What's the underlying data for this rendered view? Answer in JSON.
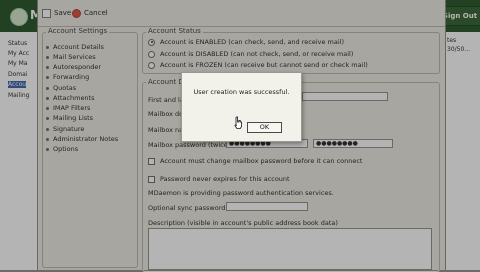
{
  "background_app": {
    "logo_text": "M",
    "sign_out_label": "Sign Out",
    "nav": [
      "Status",
      "My Acc",
      "My Ma",
      "Domai",
      "Accou",
      "Mailing"
    ],
    "right_text": [
      "tes",
      "30/50..."
    ]
  },
  "toolbar": {
    "save_label": "Save",
    "cancel_label": "Cancel"
  },
  "account_settings": {
    "legend": "Account Settings",
    "items": [
      "Account Details",
      "Mail Services",
      "Autoresponder",
      "Forwarding",
      "Quotas",
      "Attachments",
      "IMAP Filters",
      "Mailing Lists",
      "Signature",
      "Administrator Notes",
      "Options"
    ]
  },
  "account_status": {
    "legend": "Account Status",
    "options": [
      "Account is ENABLED (can check, send, and receive mail)",
      "Account is DISABLED (can not check, send, or receive mail)",
      "Account is FROZEN (can receive but cannot send or check mail)"
    ],
    "selected_index": 0
  },
  "account_details": {
    "legend": "Account De",
    "first_last_label": "First and las",
    "mailbox_domain_label": "Mailbox dom",
    "mailbox_name_label": "Mailbox nam",
    "password_label": "Mailbox password (twice):",
    "password_value": "●●●●●●●●",
    "password_confirm_value": "●●●●●●●●",
    "must_change_label": "Account must change mailbox password before it can connect",
    "never_expires_label": "Password never expires for this account",
    "auth_text": "MDaemon is providing password authentication services.",
    "sync_password_label": "Optional sync password:",
    "description_label": "Description (visible in account's public address book data)"
  },
  "modal": {
    "message": "User creation was successful.",
    "ok_label": "OK"
  }
}
